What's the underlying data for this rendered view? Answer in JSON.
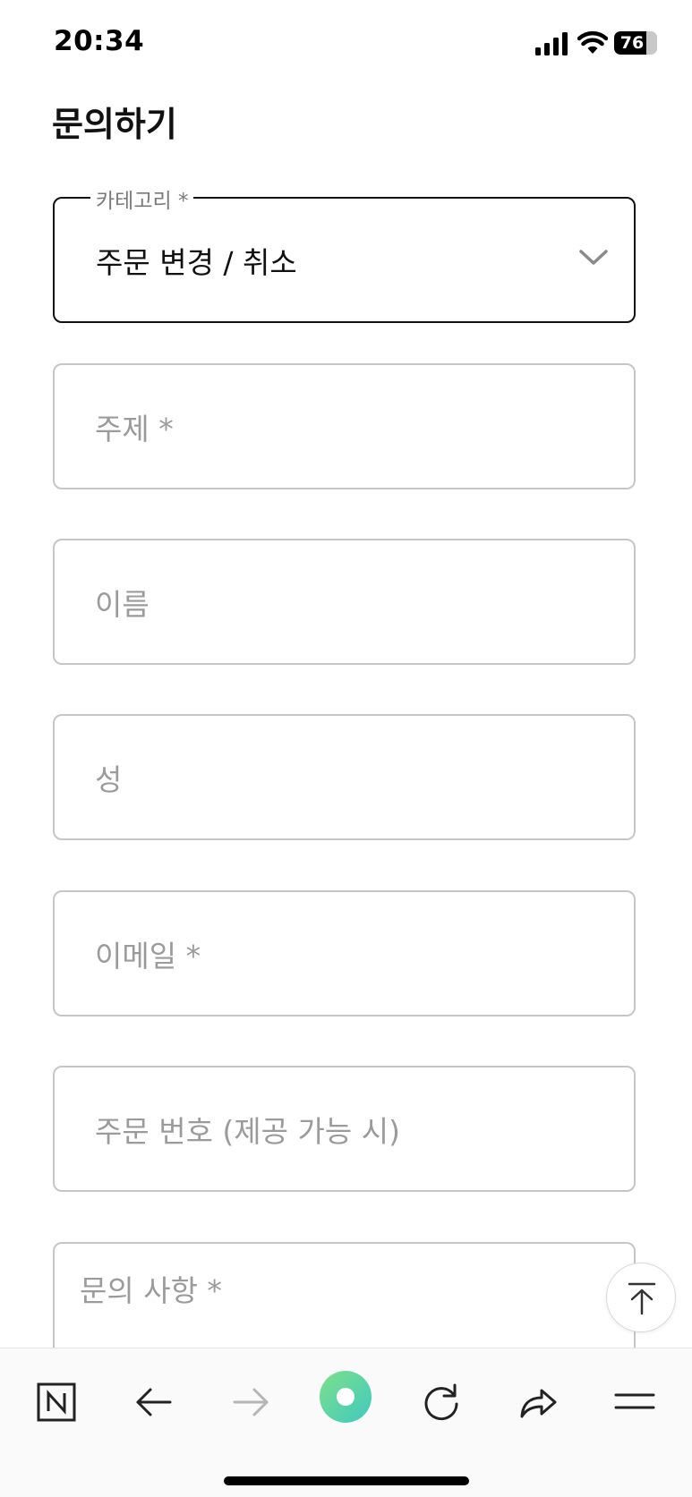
{
  "status_bar": {
    "time": "20:34",
    "battery_level": "76",
    "battery_fraction": 0.76
  },
  "page": {
    "title": "문의하기"
  },
  "form": {
    "category": {
      "legend": "카테고리 *",
      "value": "주문 변경 / 취소"
    },
    "subject": {
      "placeholder": "주제 *"
    },
    "first_name": {
      "placeholder": "이름"
    },
    "last_name": {
      "placeholder": "성"
    },
    "email": {
      "placeholder": "이메일 *"
    },
    "order_number": {
      "placeholder": "주문 번호 (제공 가능 시)"
    },
    "inquiry": {
      "placeholder": "문의 사항 *"
    }
  },
  "toolbar": {
    "items": [
      "naver-home-icon",
      "back-arrow-icon",
      "forward-arrow-icon",
      "green-dot-icon",
      "refresh-icon",
      "share-icon",
      "menu-icon"
    ]
  },
  "colors": {
    "accent_green_start": "#7ee08a",
    "accent_green_end": "#3fc9c0",
    "border_default": "#c6c6c6",
    "border_active": "#111111",
    "placeholder_text": "#9b9b9b"
  }
}
